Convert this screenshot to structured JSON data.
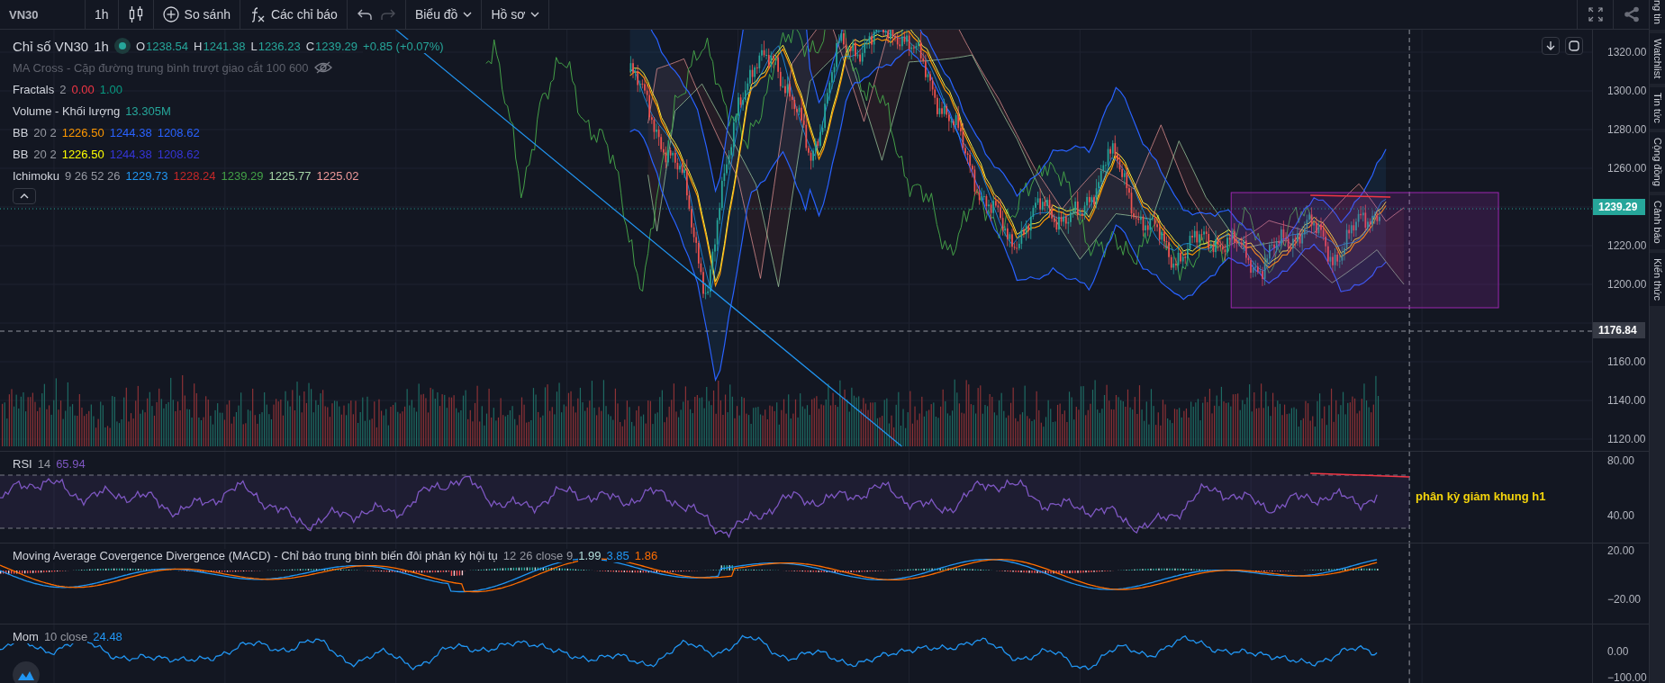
{
  "toolbar": {
    "symbol": "VN30",
    "interval": "1h",
    "buttons": [
      {
        "kind": "chart-type"
      },
      {
        "kind": "compare",
        "label": "So sánh"
      },
      {
        "kind": "indicators",
        "label": "Các chỉ báo"
      }
    ],
    "history": [
      {
        "kind": "undo",
        "disabled": false
      },
      {
        "kind": "redo",
        "disabled": true
      }
    ],
    "menus": [
      {
        "label": "Biểu đồ"
      },
      {
        "label": "Hồ sơ"
      }
    ]
  },
  "legend": {
    "title": "Chỉ số VN30",
    "interval": "1h",
    "ohlc": [
      {
        "label": "O",
        "value": "1238.54"
      },
      {
        "label": "H",
        "value": "1241.38"
      },
      {
        "label": "L",
        "value": "1236.23"
      },
      {
        "label": "C",
        "value": "1239.29"
      }
    ],
    "change": "+0.85 (+0.07%)",
    "indicators": [
      {
        "name": "MA Cross - Cặp đường trung bình trượt giao cắt 100 600",
        "hidden": true
      },
      {
        "name": "Fractals",
        "params": "2",
        "hidden": false,
        "values": [
          {
            "text": "0.00",
            "color": "#f23645"
          },
          {
            "text": "1.00",
            "color": "#089981"
          }
        ]
      },
      {
        "name": "Volume - Khối lượng",
        "hidden": false,
        "values": [
          {
            "text": "13.305M",
            "color": "#26a69a"
          }
        ]
      },
      {
        "name": "BB",
        "params": "20 2",
        "hidden": false,
        "values": [
          {
            "text": "1226.50",
            "color": "#ff9800"
          },
          {
            "text": "1244.38",
            "color": "#2962ff"
          },
          {
            "text": "1208.62",
            "color": "#2962ff"
          }
        ]
      },
      {
        "name": "BB",
        "params": "20 2",
        "hidden": false,
        "values": [
          {
            "text": "1226.50",
            "color": "#ffff00"
          },
          {
            "text": "1244.38",
            "color": "#3535d8"
          },
          {
            "text": "1208.62",
            "color": "#3535d8"
          }
        ]
      },
      {
        "name": "Ichimoku",
        "params": "9 26 52 26",
        "hidden": false,
        "values": [
          {
            "text": "1229.73",
            "color": "#2196f3"
          },
          {
            "text": "1228.24",
            "color": "#c62828"
          },
          {
            "text": "1239.29",
            "color": "#43a047"
          },
          {
            "text": "1225.77",
            "color": "#a5d6a7"
          },
          {
            "text": "1225.02",
            "color": "#ef9a9a"
          }
        ]
      }
    ]
  },
  "panes": [
    {
      "kind": "price",
      "axis": [
        {
          "kind": "tick",
          "text": "1320.00"
        },
        {
          "kind": "tick",
          "text": "1300.00"
        },
        {
          "kind": "tick",
          "text": "1280.00"
        },
        {
          "kind": "tick",
          "text": "1260.00"
        },
        {
          "kind": "last",
          "text": "1239.29"
        },
        {
          "kind": "tick",
          "text": "1220.00"
        },
        {
          "kind": "tick",
          "text": "1200.00"
        },
        {
          "kind": "crosshair",
          "text": "1176.84"
        },
        {
          "kind": "tick",
          "text": "1160.00"
        },
        {
          "kind": "tick",
          "text": "1140.00"
        },
        {
          "kind": "tick",
          "text": "1120.00"
        }
      ]
    },
    {
      "kind": "rsi",
      "name": "RSI",
      "params": "14",
      "values": [
        {
          "text": "65.94",
          "color": "#7e57c2"
        }
      ],
      "axis": [
        {
          "kind": "tick",
          "text": "80.00"
        },
        {
          "kind": "tick",
          "text": "40.00"
        }
      ],
      "annotation": "phân kỳ giảm khung h1"
    },
    {
      "kind": "macd",
      "name": "Moving Average Covergence Divergence (MACD) - Chỉ báo trung bình biến đôi phân kỳ hội tụ",
      "params": "12 26 close 9",
      "values": [
        {
          "text": "1.99",
          "color": "#b2dfdb"
        },
        {
          "text": "3.85",
          "color": "#2196f3"
        },
        {
          "text": "1.86",
          "color": "#ff6d00"
        }
      ],
      "axis": [
        {
          "kind": "tick",
          "text": "20.00"
        },
        {
          "kind": "tick",
          "text": "−20.00"
        }
      ]
    },
    {
      "kind": "mom",
      "name": "Mom",
      "params": "10 close",
      "values": [
        {
          "text": "24.48",
          "color": "#2196f3"
        }
      ],
      "axis": [
        {
          "kind": "tick",
          "text": "0.00"
        },
        {
          "kind": "tick",
          "text": "−100.00"
        }
      ]
    }
  ],
  "sidebar": {
    "items": [
      {
        "label": "ng tin"
      },
      {
        "label": "Watchlist"
      },
      {
        "label": "Tin tức"
      },
      {
        "label": "Cộng đồng"
      },
      {
        "label": "Cảnh báo"
      },
      {
        "label": "Kiến thức"
      }
    ]
  }
}
